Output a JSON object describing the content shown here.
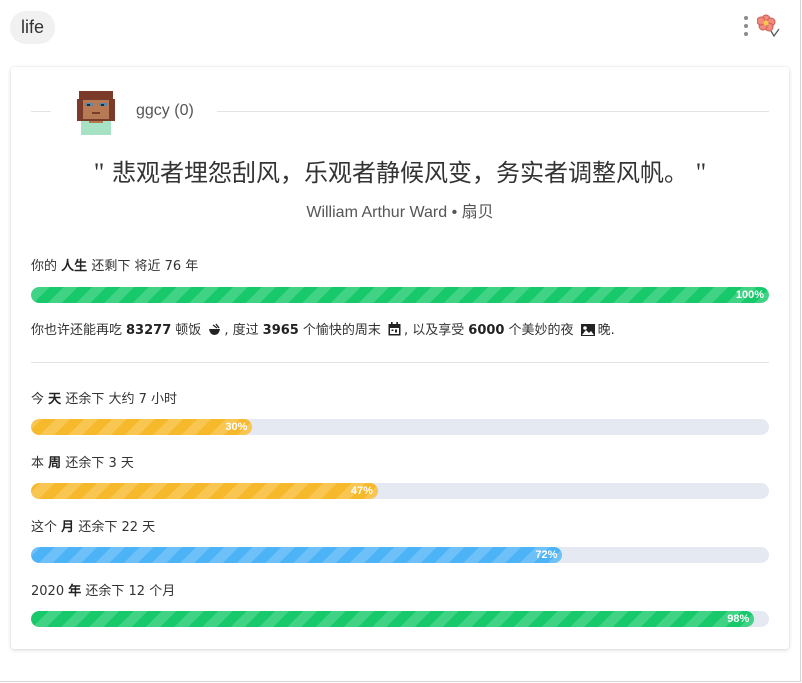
{
  "header": {
    "tag_label": "life",
    "menu_icon": "more-vertical-icon",
    "logo_icon": "flower-icon"
  },
  "profile": {
    "username": "ggcy (0)"
  },
  "quote": {
    "open_mark": "\"",
    "text": "悲观者埋怨刮风，乐观者静候风变，务实者调整风帆。",
    "close_mark": "\"",
    "author": "William Arthur Ward",
    "separator": "•",
    "source": "扇贝"
  },
  "life": {
    "prefix": "你的",
    "keyword": "人生",
    "suffix": "还剩下 将近 76 年",
    "percent": 100,
    "percent_label": "100%"
  },
  "stats": {
    "t1": "你也许还能再吃",
    "meals": "83277",
    "t2": "顿饭",
    "t3": ", 度过",
    "weekends": "3965",
    "t4": "个愉快的周末",
    "t5": ", 以及享受",
    "nights": "6000",
    "t6": "个美妙的夜",
    "t7": "晚.",
    "meal_icon": "bowl-icon",
    "weekend_icon": "calendar-icon",
    "night_icon": "night-icon"
  },
  "progress": [
    {
      "prefix": "今",
      "keyword": "天",
      "suffix": "还余下 大约 7 小时",
      "percent": 30,
      "percent_label": "30%",
      "color": "yellow"
    },
    {
      "prefix": "本",
      "keyword": "周",
      "suffix": "还余下 3 天",
      "percent": 47,
      "percent_label": "47%",
      "color": "yellow"
    },
    {
      "prefix": "这个",
      "keyword": "月",
      "suffix": "还余下 22 天",
      "percent": 72,
      "percent_label": "72%",
      "color": "blue"
    },
    {
      "prefix": "2020",
      "keyword": "年",
      "suffix": "还余下 12 个月",
      "percent": 98,
      "percent_label": "98%",
      "color": "green"
    }
  ],
  "colors": {
    "green": "#17c96a",
    "yellow": "#f6b92b",
    "blue": "#4db3f7",
    "track": "#e4e9f2"
  }
}
